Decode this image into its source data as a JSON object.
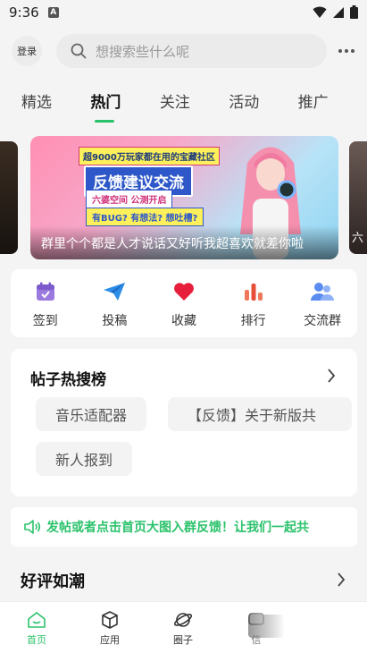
{
  "status_bar": {
    "time": "9:36",
    "app_icon": "A"
  },
  "top": {
    "login_label": "登录",
    "search_placeholder": "想搜索些什么呢",
    "more_icon": "more-dots-icon"
  },
  "tabs": [
    {
      "label": "精选",
      "active": false
    },
    {
      "label": "热门",
      "active": true
    },
    {
      "label": "关注",
      "active": false
    },
    {
      "label": "活动",
      "active": false
    },
    {
      "label": "推广",
      "active": false
    }
  ],
  "banner": {
    "top_line": "超9000万玩家都在用的宝藏社区",
    "headline": "反馈建议交流",
    "chip1": "六婆空间 公测开启",
    "chip2": "有BUG? 有想法? 想吐槽?",
    "caption": "群里个个都是人才说话又好听我超喜欢就差你啦",
    "side_caption": "六"
  },
  "quick_actions": [
    {
      "label": "签到",
      "icon": "calendar-icon"
    },
    {
      "label": "投稿",
      "icon": "paper-plane-icon"
    },
    {
      "label": "收藏",
      "icon": "heart-icon"
    },
    {
      "label": "排行",
      "icon": "ranking-bars-icon"
    },
    {
      "label": "交流群",
      "icon": "group-icon"
    }
  ],
  "hot_search": {
    "title": "帖子热搜榜",
    "chips": [
      "音乐适配器",
      "【反馈】关于新版共",
      "新人报到"
    ]
  },
  "notice": {
    "text": "发帖或者点击首页大图入群反馈！让我们一起共"
  },
  "section": {
    "title": "好评如潮"
  },
  "bottom_nav": [
    {
      "label": "首页",
      "icon": "home-icon",
      "active": true
    },
    {
      "label": "应用",
      "icon": "cube-icon",
      "active": false
    },
    {
      "label": "圈子",
      "icon": "planet-icon",
      "active": false
    },
    {
      "label": "信",
      "icon": "message-icon",
      "active": false
    }
  ],
  "colors": {
    "accent": "#2bc26b",
    "background": "#f4f4f4",
    "card": "#ffffff"
  }
}
